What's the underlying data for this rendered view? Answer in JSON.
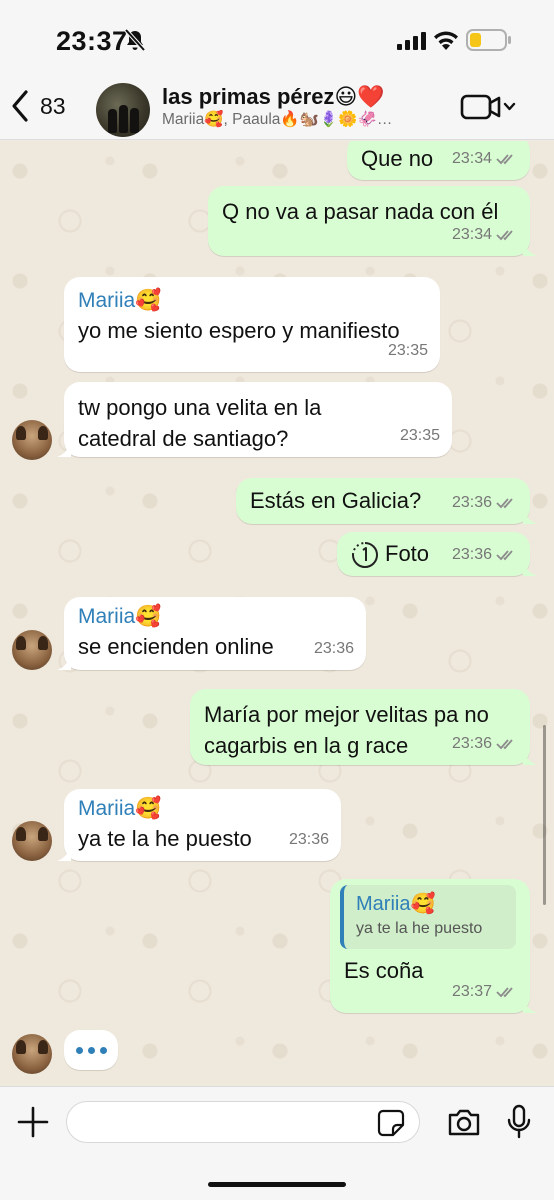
{
  "status_bar": {
    "time": "23:37"
  },
  "header": {
    "unread_count": "83",
    "title": "las primas pérez😃❤️",
    "subtitle": "Mariia🥰, Paaula🔥🐿️🪻🌼🦑…"
  },
  "messages": [
    {
      "type": "out",
      "text": "Que no",
      "time": "23:34"
    },
    {
      "type": "out",
      "text": "Q no va a pasar nada con él",
      "time": "23:34"
    },
    {
      "type": "in",
      "sender": "Mariia🥰",
      "text": "yo me siento espero y manifiesto",
      "time": "23:35"
    },
    {
      "type": "in",
      "text": "tw pongo una velita en la catedral de santiago?",
      "time": "23:35"
    },
    {
      "type": "out",
      "text": "Estás en Galicia?",
      "time": "23:36"
    },
    {
      "type": "out",
      "text": "Foto",
      "time": "23:36",
      "view_once": true
    },
    {
      "type": "in",
      "sender": "Mariia🥰",
      "text": "se encienden online",
      "time": "23:36"
    },
    {
      "type": "out",
      "text": "María por mejor velitas pa no cagarbis en la g race",
      "time": "23:36"
    },
    {
      "type": "in",
      "sender": "Mariia🥰",
      "text": "ya te la he puesto",
      "time": "23:36"
    },
    {
      "type": "out",
      "quote_sender": "Mariia🥰",
      "quote_text": "ya te la he puesto",
      "text": "Es coña",
      "time": "23:37"
    }
  ],
  "input": {
    "value": "",
    "placeholder": ""
  },
  "icons": {
    "status": [
      "bell-off-icon",
      "signal-icon",
      "wifi-icon",
      "battery-icon"
    ],
    "header": [
      "back-chevron-icon",
      "video-camera-icon",
      "chevron-down-icon"
    ],
    "input": [
      "plus-icon",
      "sticker-icon",
      "camera-icon",
      "microphone-icon"
    ]
  },
  "colors": {
    "outgoing_bubble": "#d9fdd3",
    "incoming_bubble": "#ffffff",
    "sender_name": "#2f7fb8",
    "read_ticks": "#8c8c8c",
    "battery_fill": "#f5c518"
  }
}
